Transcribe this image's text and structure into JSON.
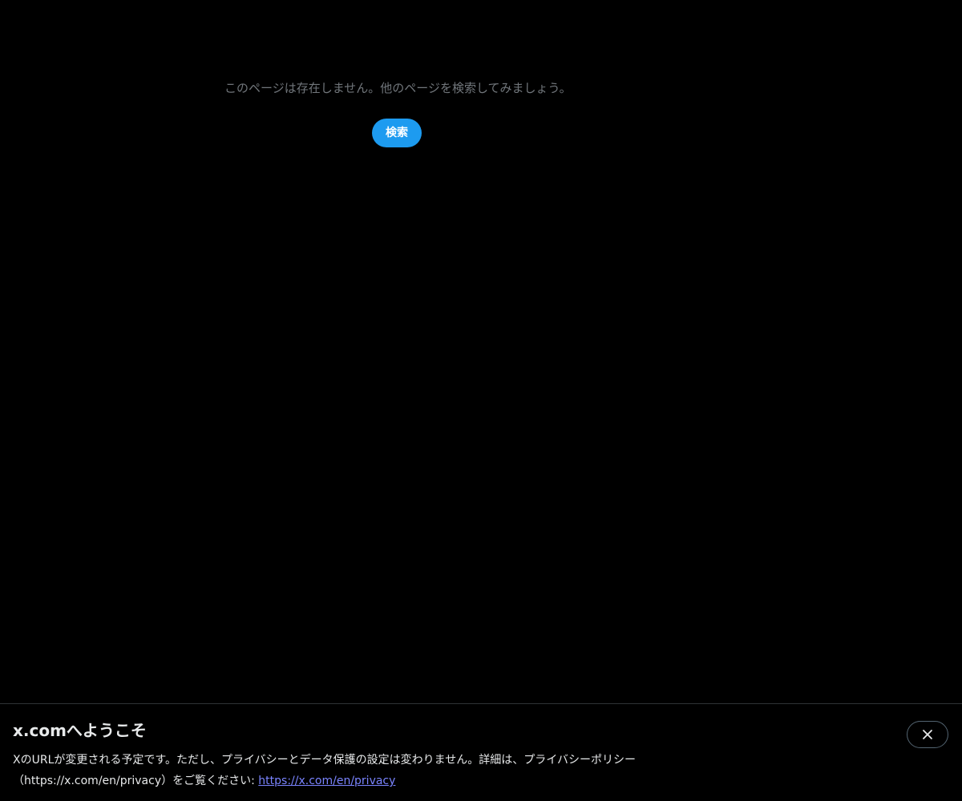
{
  "empty_state": {
    "message": "このページは存在しません。他のページを検索してみましょう。",
    "search_button_label": "検索"
  },
  "banner": {
    "title": "x.comへようこそ",
    "body_text": "XのURLが変更される予定です。ただし、プライバシーとデータ保護の設定は変わりません。詳細は、プライバシーポリシー（https://x.com/en/privacy）をご覧ください: ",
    "link_text": "https://x.com/en/privacy",
    "close_icon": "close-icon"
  },
  "colors": {
    "background": "#000000",
    "accent": "#1d9bf0",
    "muted_text": "#71767b",
    "link": "#7a84ff",
    "primary_text": "#e7e9ea"
  }
}
